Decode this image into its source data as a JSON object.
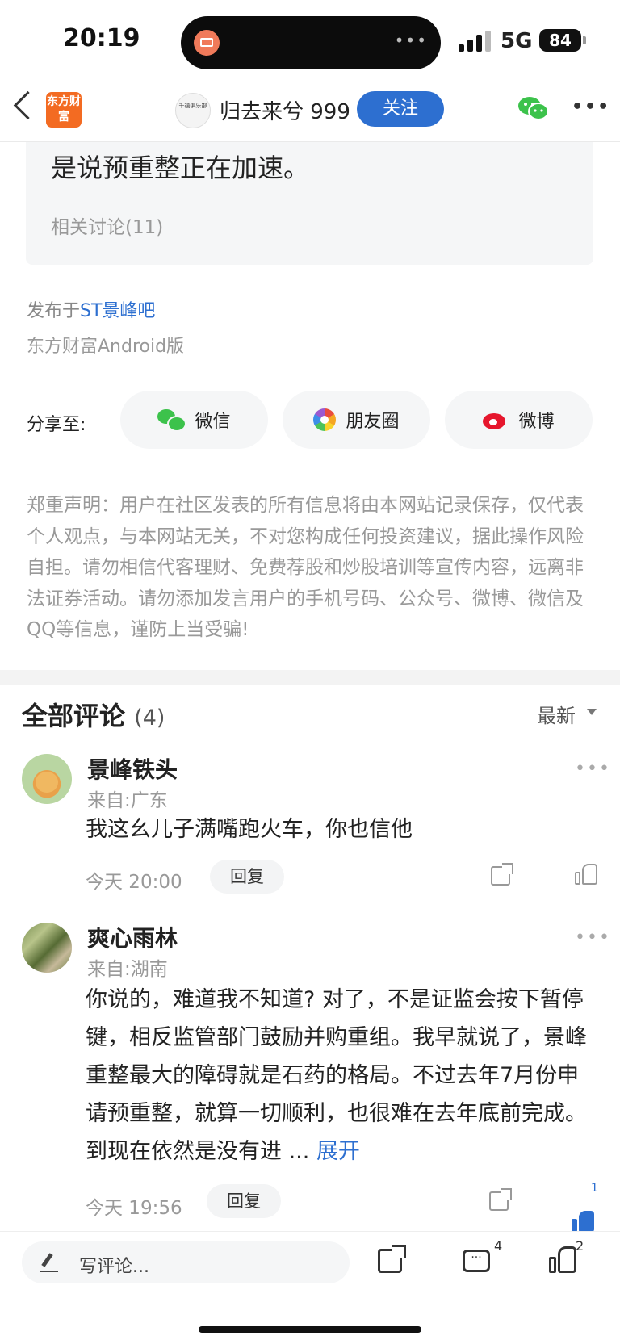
{
  "status_bar": {
    "time": "20:19",
    "network": "5G",
    "battery": "84"
  },
  "nav": {
    "logo_text": "东方财富",
    "author_avatar_text": "千禧俱乐部",
    "author_name": "归去来兮 999",
    "follow_label": "关注"
  },
  "post": {
    "quote_text": "是说预重整正在加速。",
    "related_label": "相关讨论(11)",
    "published_prefix": "发布于",
    "published_bar": "ST景峰吧",
    "client": "东方财富Android版"
  },
  "share": {
    "label": "分享至:",
    "wechat": "微信",
    "moments": "朋友圈",
    "weibo": "微博"
  },
  "disclaimer": "郑重声明：用户在社区发表的所有信息将由本网站记录保存，仅代表个人观点，与本网站无关，不对您构成任何投资建议，据此操作风险自担。请勿相信代客理财、免费荐股和炒股培训等宣传内容，远离非法证券活动。请勿添加发言用户的手机号码、公众号、微博、微信及QQ等信息，谨防上当受骗!",
  "comments": {
    "title": "全部评论",
    "count": "(4)",
    "sort_label": "最新",
    "items": [
      {
        "name": "景峰铁头",
        "location": "来自:广东",
        "text": "我这幺儿子满嘴跑火车，你也信他",
        "time": "今天 20:00",
        "reply_label": "回复"
      },
      {
        "name": "爽心雨林",
        "location": "来自:湖南",
        "text": "你说的，难道我不知道? 对了，不是证监会按下暂停键，相反监管部门鼓励并购重组。我早就说了，景峰重整最大的障碍就是石药的格局。不过去年7月份申请预重整，就算一切顺利，也很难在去年底前完成。到现在依然是没有进 ...",
        "expand_label": "展开",
        "time": "今天 19:56",
        "reply_label": "回复",
        "like_count": "1"
      }
    ]
  },
  "bottom_bar": {
    "write_placeholder": "写评论...",
    "comment_count": "4",
    "like_count": "2"
  }
}
